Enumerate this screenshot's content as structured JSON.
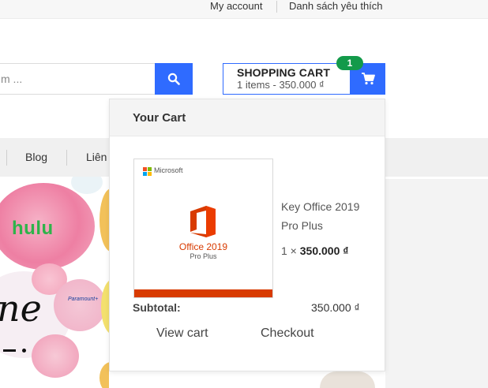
{
  "topbar": {
    "my_account": "My account",
    "wishlist": "Danh sách yêu thích"
  },
  "search": {
    "placeholder_fragment": "m ..."
  },
  "cart_header": {
    "title": "SHOPPING CART",
    "summary": "1 items - 350.000 ₫",
    "badge": "1"
  },
  "nav": {
    "items": [
      "Blog",
      "Liên"
    ]
  },
  "hero": {
    "hulu": "hulu",
    "paramount": "Paramount+",
    "script_text": "ne"
  },
  "dropdown": {
    "title": "Your Cart",
    "product": {
      "brand": "Microsoft",
      "image_title": "Office 2019",
      "image_subtitle": "Pro Plus",
      "name": "Key Office 2019 Pro Plus",
      "qty_prefix": "1 ×",
      "price": "350.000 ₫"
    },
    "subtotal_label": "Subtotal:",
    "subtotal_value": "350.000 ₫",
    "view_cart": "View cart",
    "checkout": "Checkout"
  },
  "colors": {
    "accent": "#2f6bff",
    "badge": "#139a4a",
    "office": "#d83b01"
  },
  "icons": {
    "search": "search-icon",
    "cart": "cart-icon",
    "office": "office-icon"
  }
}
